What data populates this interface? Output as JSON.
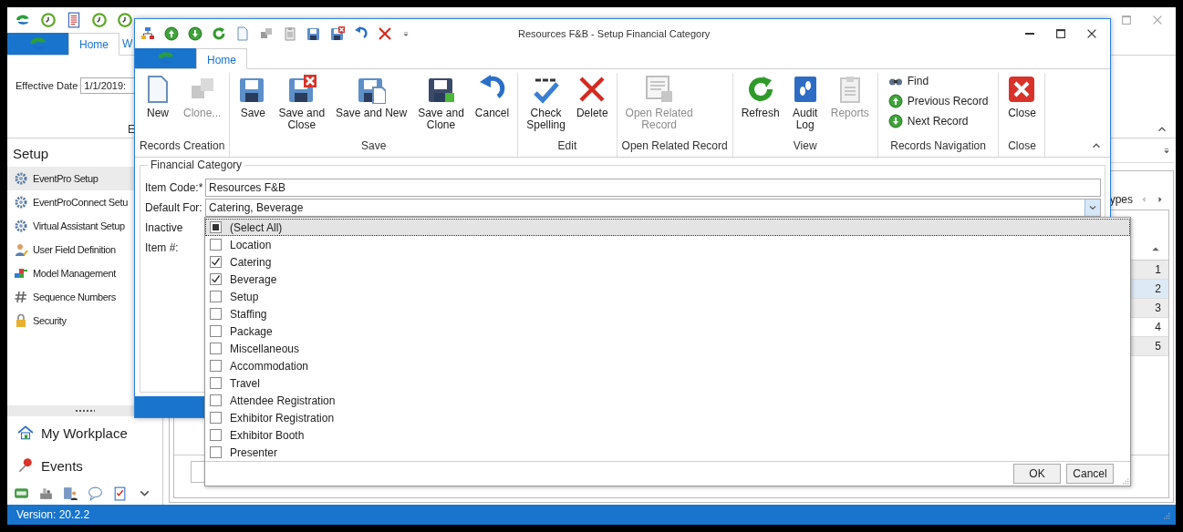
{
  "app": {
    "tabs": [
      {
        "label": "Home",
        "selected": true
      },
      {
        "label": "W",
        "selected": false
      }
    ],
    "effective_date": {
      "label": "Effective Date",
      "value": "1/1/2019:"
    },
    "group_label": "E",
    "sidebar": {
      "title": "Setup",
      "items": [
        {
          "label": "EventPro Setup",
          "selected": true
        },
        {
          "label": "EventProConnect Setu",
          "selected": false
        },
        {
          "label": "Virtual Assistant Setup",
          "selected": false
        },
        {
          "label": "User Field Definition",
          "selected": false
        },
        {
          "label": "Model Management",
          "selected": false
        },
        {
          "label": "Sequence Numbers",
          "selected": false
        },
        {
          "label": "Security",
          "selected": false
        }
      ]
    },
    "nav": [
      {
        "label": "My Workplace"
      },
      {
        "label": "Events"
      }
    ],
    "grid": {
      "tab_label": "ypes",
      "rows": [
        {
          "value": "1",
          "selected": false
        },
        {
          "value": "2",
          "selected": true
        },
        {
          "value": "3",
          "selected": false
        },
        {
          "value": "4",
          "selected": false
        },
        {
          "value": "5",
          "selected": false
        }
      ]
    },
    "status_bar": "Version: 20.2.2"
  },
  "dialog": {
    "title": "Resources F&B - Setup Financial Category",
    "tabs": [
      {
        "label": "Home",
        "selected": true
      }
    ],
    "ribbon_groups": [
      {
        "label": "Records Creation",
        "kind": "large",
        "buttons": [
          {
            "label": "New",
            "disabled": false
          },
          {
            "label": "Clone...",
            "disabled": true
          }
        ]
      },
      {
        "label": "Save",
        "kind": "large",
        "buttons": [
          {
            "label": "Save",
            "disabled": false
          },
          {
            "label": "Save and\nClose",
            "disabled": false
          },
          {
            "label": "Save and New",
            "disabled": false
          },
          {
            "label": "Save and\nClone",
            "disabled": false
          },
          {
            "label": "Cancel",
            "disabled": false
          }
        ]
      },
      {
        "label": "Edit",
        "kind": "large",
        "buttons": [
          {
            "label": "Check\nSpelling",
            "disabled": false
          },
          {
            "label": "Delete",
            "disabled": false
          }
        ]
      },
      {
        "label": "Open Related Record",
        "kind": "large",
        "buttons": [
          {
            "label": "Open Related\nRecord",
            "disabled": true
          }
        ]
      },
      {
        "label": "View",
        "kind": "large",
        "buttons": [
          {
            "label": "Refresh",
            "disabled": false
          },
          {
            "label": "Audit\nLog",
            "disabled": false
          },
          {
            "label": "Reports",
            "disabled": true
          }
        ]
      },
      {
        "label": "Records Navigation",
        "kind": "small",
        "buttons": [
          {
            "label": "Find",
            "disabled": false
          },
          {
            "label": "Previous Record",
            "disabled": false
          },
          {
            "label": "Next Record",
            "disabled": false
          }
        ]
      },
      {
        "label": "Close",
        "kind": "large",
        "buttons": [
          {
            "label": "Close",
            "disabled": false
          }
        ]
      }
    ],
    "group_box": "Financial Category",
    "fields": [
      {
        "label": "Item Code:*",
        "kind": "text",
        "value": "Resources F&B"
      },
      {
        "label": "Default For:",
        "kind": "combo",
        "value": "Catering, Beverage"
      },
      {
        "label": "Inactive",
        "kind": "label"
      },
      {
        "label": "Item #:",
        "kind": "label"
      }
    ],
    "dropdown": {
      "items": [
        {
          "label": "(Select All)",
          "kind": "select_all",
          "indeterminate": true,
          "selected": true
        },
        {
          "label": "Location",
          "kind": "option",
          "checked": false,
          "selected": false
        },
        {
          "label": "Catering",
          "kind": "option",
          "checked": true,
          "selected": false
        },
        {
          "label": "Beverage",
          "kind": "option",
          "checked": true,
          "selected": false
        },
        {
          "label": "Setup",
          "kind": "option",
          "checked": false,
          "selected": false
        },
        {
          "label": "Staffing",
          "kind": "option",
          "checked": false,
          "selected": false
        },
        {
          "label": "Package",
          "kind": "option",
          "checked": false,
          "selected": false
        },
        {
          "label": "Miscellaneous",
          "kind": "option",
          "checked": false,
          "selected": false
        },
        {
          "label": "Accommodation",
          "kind": "option",
          "checked": false,
          "selected": false
        },
        {
          "label": "Travel",
          "kind": "option",
          "checked": false,
          "selected": false
        },
        {
          "label": "Attendee Registration",
          "kind": "option",
          "checked": false,
          "selected": false
        },
        {
          "label": "Exhibitor Registration",
          "kind": "option",
          "checked": false,
          "selected": false
        },
        {
          "label": "Exhibitor Booth",
          "kind": "option",
          "checked": false,
          "selected": false
        },
        {
          "label": "Presenter",
          "kind": "option",
          "checked": false,
          "selected": false
        }
      ],
      "buttons": [
        "OK",
        "Cancel"
      ]
    }
  }
}
